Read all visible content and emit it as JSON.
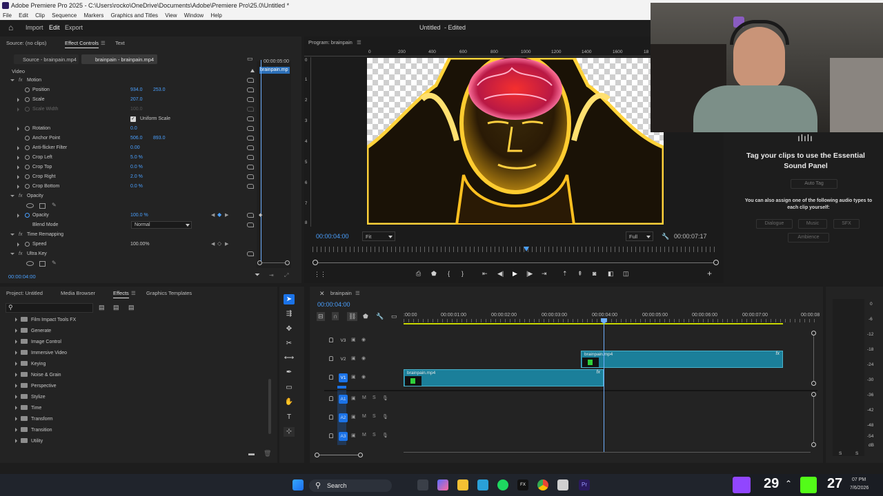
{
  "window": {
    "title": "Adobe Premiere Pro 2025 - C:\\Users\\rocko\\OneDrive\\Documents\\Adobe\\Premiere Pro\\25.0\\Untitled *",
    "menu": [
      "File",
      "Edit",
      "Clip",
      "Sequence",
      "Markers",
      "Graphics and Titles",
      "View",
      "Window",
      "Help"
    ]
  },
  "workspace": {
    "tabs": [
      "Import",
      "Edit",
      "Export"
    ],
    "active": "Edit",
    "project_title": "Untitled",
    "project_status": "- Edited"
  },
  "source_panel": {
    "tabs": [
      "Source: (no clips)",
      "Effect Controls",
      "Text"
    ],
    "subtabs": [
      "Source - brainpain.mp4",
      "brainpain - brainpain.mp4"
    ],
    "time_ruler": "00:00:05:00",
    "clip_label": "brainpain.mp",
    "video_heading": "Video",
    "current_time": "00:00:04:00",
    "properties": [
      {
        "label": "Motion",
        "v1": "",
        "v2": ""
      },
      {
        "label": "Position",
        "v1": "934.0",
        "v2": "253.0"
      },
      {
        "label": "Scale",
        "v1": "207.0",
        "v2": ""
      },
      {
        "label": "Scale Width",
        "v1": "100.0",
        "v2": ""
      },
      {
        "label": "Uniform Scale",
        "v1": "",
        "v2": ""
      },
      {
        "label": "Rotation",
        "v1": "0.0",
        "v2": ""
      },
      {
        "label": "Anchor Point",
        "v1": "506.0",
        "v2": "893.0"
      },
      {
        "label": "Anti-flicker Filter",
        "v1": "0.00",
        "v2": ""
      },
      {
        "label": "Crop Left",
        "v1": "5.0 %",
        "v2": ""
      },
      {
        "label": "Crop Top",
        "v1": "0.0 %",
        "v2": ""
      },
      {
        "label": "Crop Right",
        "v1": "2.0 %",
        "v2": ""
      },
      {
        "label": "Crop Bottom",
        "v1": "0.0 %",
        "v2": ""
      },
      {
        "label": "Opacity",
        "v1": "",
        "v2": ""
      },
      {
        "label": "Opacity",
        "v1": "100.0 %",
        "v2": ""
      },
      {
        "label": "Blend Mode",
        "v1": "Normal",
        "v2": ""
      },
      {
        "label": "Time Remapping",
        "v1": "",
        "v2": ""
      },
      {
        "label": "Speed",
        "v1": "100.00%",
        "v2": ""
      },
      {
        "label": "Ultra Key",
        "v1": "",
        "v2": ""
      }
    ]
  },
  "program_monitor": {
    "title": "Program: brainpain",
    "ruler": [
      "0",
      "200",
      "400",
      "600",
      "800",
      "1000",
      "1200",
      "1400",
      "1600",
      "18"
    ],
    "left_ruler": [
      "0",
      "1",
      "2",
      "3",
      "4",
      "5",
      "6",
      "7",
      "8"
    ],
    "timecode": "00:00:04:00",
    "zoom": "Fit",
    "quality": "Full",
    "duration": "00:00:07:17"
  },
  "essential_sound": {
    "heading": "Tag your clips to use the Essential Sound Panel",
    "auto_tag": "Auto Tag",
    "assign_text": "You can also assign one of the following audio types to each clip yourself:",
    "types": [
      "Dialogue",
      "Music",
      "SFX",
      "Ambience"
    ]
  },
  "project_panel": {
    "tabs": [
      "Project: Untitled",
      "Media Browser",
      "Effects",
      "Graphics Templates"
    ],
    "active_tab": "Effects",
    "search_placeholder": "",
    "folders": [
      "Film Impact Tools FX",
      "Generate",
      "Image Control",
      "Immersive Video",
      "Keying",
      "Noise & Grain",
      "Perspective",
      "Stylize",
      "Time",
      "Transform",
      "Transition",
      "Utility"
    ]
  },
  "timeline": {
    "sequence_name": "brainpain",
    "timecode": "00:00:04:00",
    "ruler": [
      ":00:00",
      "00:00:01:00",
      "00:00:02:00",
      "00:00:03:00",
      "00:00:04:00",
      "00:00:05:00",
      "00:00:06:00",
      "00:00:07:00",
      "00:00:08"
    ],
    "video_tracks": [
      "V3",
      "V2",
      "V1"
    ],
    "audio_tracks": [
      "A1",
      "A2",
      "A3"
    ],
    "clips": [
      {
        "name": "brainpain.mp4",
        "track": "V2",
        "fx": "fx"
      },
      {
        "name": "brainpain.mp4",
        "track": "V1",
        "fx": "fx"
      }
    ]
  },
  "audio_meter": {
    "scale": [
      "0",
      "-6",
      "-12",
      "-18",
      "-24",
      "-30",
      "-36",
      "-42",
      "-48",
      "-54",
      "dB"
    ],
    "channels": [
      "S",
      "S"
    ]
  },
  "taskbar": {
    "search_label": "Search",
    "overlay_count": "29",
    "overlay_count2": "27",
    "clock_time": "07 PM",
    "clock_date": "7/6/2026"
  },
  "colors": {
    "accent": "#1b73e8",
    "clip": "#1b7f9a",
    "value_blue": "#4aa0ff",
    "playhead": "#6fb0ff"
  }
}
